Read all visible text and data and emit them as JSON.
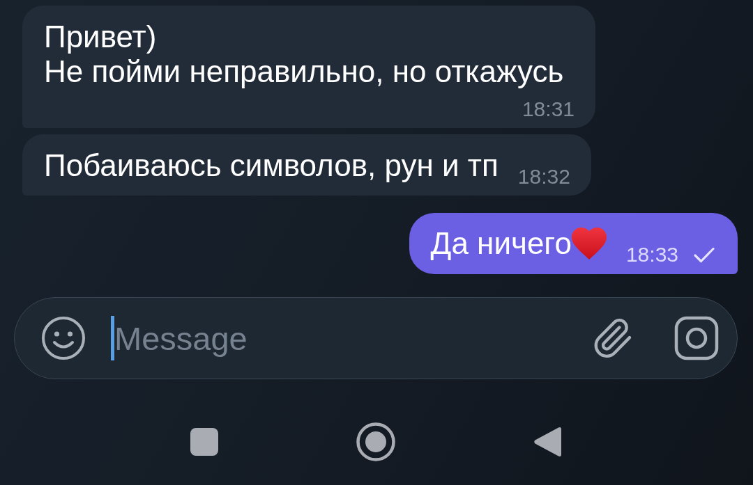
{
  "messages": [
    {
      "kind": "incoming",
      "text": "Привет)\nНе пойми неправильно, но откажусь",
      "time": "18:31"
    },
    {
      "kind": "incoming",
      "text": "Побаиваюсь символов, рун и тп",
      "time": "18:32"
    },
    {
      "kind": "outgoing",
      "text": "Да ничего",
      "with_emoji": true,
      "time": "18:33",
      "read": false
    }
  ],
  "composer": {
    "placeholder": "Message",
    "focused": true
  }
}
